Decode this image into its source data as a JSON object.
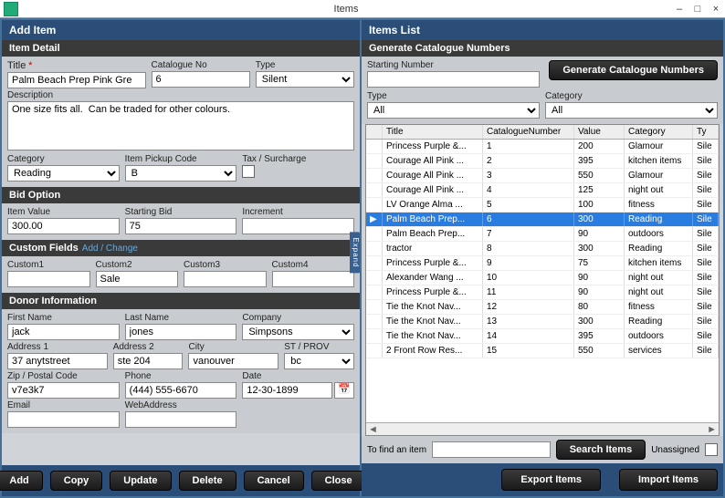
{
  "window": {
    "title": "Items",
    "min": "–",
    "max": "□",
    "close": "×"
  },
  "left": {
    "addItem": "Add Item",
    "itemDetail": "Item Detail",
    "titleLbl": "Title",
    "catNoLbl": "Catalogue No",
    "typeLbl": "Type",
    "title": "Palm Beach Prep Pink Gre",
    "catNo": "6",
    "type": "Silent",
    "descLbl": "Description",
    "desc": "One size fits all.  Can be traded for other colours.",
    "categoryLbl": "Category",
    "pickupLbl": "Item Pickup Code",
    "taxLbl": "Tax / Surcharge",
    "category": "Reading",
    "pickup": "B",
    "bidOption": "Bid Option",
    "valueLbl": "Item Value",
    "startBidLbl": "Starting Bid",
    "incLbl": "Increment",
    "value": "300.00",
    "startBid": "75",
    "inc": "",
    "customFields": "Custom Fields",
    "customLink": "Add / Change",
    "c1Lbl": "Custom1",
    "c2Lbl": "Custom2",
    "c3Lbl": "Custom3",
    "c4Lbl": "Custom4",
    "c1": "",
    "c2": "Sale",
    "c3": "",
    "c4": "",
    "donorInfo": "Donor Information",
    "fnLbl": "First Name",
    "lnLbl": "Last Name",
    "coLbl": "Company",
    "fn": "jack",
    "ln": "jones",
    "co": "Simpsons",
    "a1Lbl": "Address 1",
    "a2Lbl": "Address 2",
    "cityLbl": "City",
    "stLbl": "ST / PROV",
    "a1": "37 anytstreet",
    "a2": "ste 204",
    "city": "vanouver",
    "st": "bc",
    "zipLbl": "Zip / Postal Code",
    "phoneLbl": "Phone",
    "dateLbl": "Date",
    "zip": "v7e3k7",
    "phone": "(444) 555-6670",
    "date": "12-30-1899",
    "emailLbl": "Email",
    "webLbl": "WebAddress",
    "email": "",
    "web": "",
    "expand": "Expand",
    "btns": {
      "add": "Add",
      "copy": "Copy",
      "update": "Update",
      "delete": "Delete",
      "cancel": "Cancel",
      "close": "Close"
    }
  },
  "right": {
    "itemsList": "Items List",
    "genHdr": "Generate Catalogue Numbers",
    "genBtn": "Generate Catalogue Numbers",
    "startNumLbl": "Starting Number",
    "startNum": "",
    "typeLbl": "Type",
    "catLbl": "Category",
    "typeSel": "All",
    "catSel": "All",
    "cols": {
      "title": "Title",
      "cat": "CatalogueNumber",
      "val": "Value",
      "category": "Category",
      "ty": "Ty"
    },
    "rows": [
      {
        "t": "Princess Purple &...",
        "n": "1",
        "v": "200",
        "c": "Glamour",
        "y": "Sile"
      },
      {
        "t": "Courage All Pink ...",
        "n": "2",
        "v": "395",
        "c": "kitchen items",
        "y": "Sile"
      },
      {
        "t": "Courage All Pink ...",
        "n": "3",
        "v": "550",
        "c": "Glamour",
        "y": "Sile"
      },
      {
        "t": "Courage All Pink ...",
        "n": "4",
        "v": "125",
        "c": "night out",
        "y": "Sile"
      },
      {
        "t": "LV Orange Alma ...",
        "n": "5",
        "v": "100",
        "c": "fitness",
        "y": "Sile"
      },
      {
        "t": "Palm Beach Prep...",
        "n": "6",
        "v": "300",
        "c": "Reading",
        "y": "Sile",
        "sel": true
      },
      {
        "t": "Palm Beach Prep...",
        "n": "7",
        "v": "90",
        "c": "outdoors",
        "y": "Sile"
      },
      {
        "t": "tractor",
        "n": "8",
        "v": "300",
        "c": "Reading",
        "y": "Sile"
      },
      {
        "t": "Princess Purple &...",
        "n": "9",
        "v": "75",
        "c": "kitchen items",
        "y": "Sile"
      },
      {
        "t": "Alexander Wang ...",
        "n": "10",
        "v": "90",
        "c": "night out",
        "y": "Sile"
      },
      {
        "t": "Princess Purple &...",
        "n": "11",
        "v": "90",
        "c": "night out",
        "y": "Sile"
      },
      {
        "t": "Tie the Knot Nav...",
        "n": "12",
        "v": "80",
        "c": "fitness",
        "y": "Sile"
      },
      {
        "t": "Tie the Knot Nav...",
        "n": "13",
        "v": "300",
        "c": "Reading",
        "y": "Sile"
      },
      {
        "t": "Tie the Knot Nav...",
        "n": "14",
        "v": "395",
        "c": "outdoors",
        "y": "Sile"
      },
      {
        "t": "2 Front Row Res...",
        "n": "15",
        "v": "550",
        "c": "services",
        "y": "Sile"
      }
    ],
    "findLbl": "To find an item",
    "find": "",
    "searchBtn": "Search Items",
    "unassignedLbl": "Unassigned",
    "exportBtn": "Export Items",
    "importBtn": "Import Items"
  }
}
